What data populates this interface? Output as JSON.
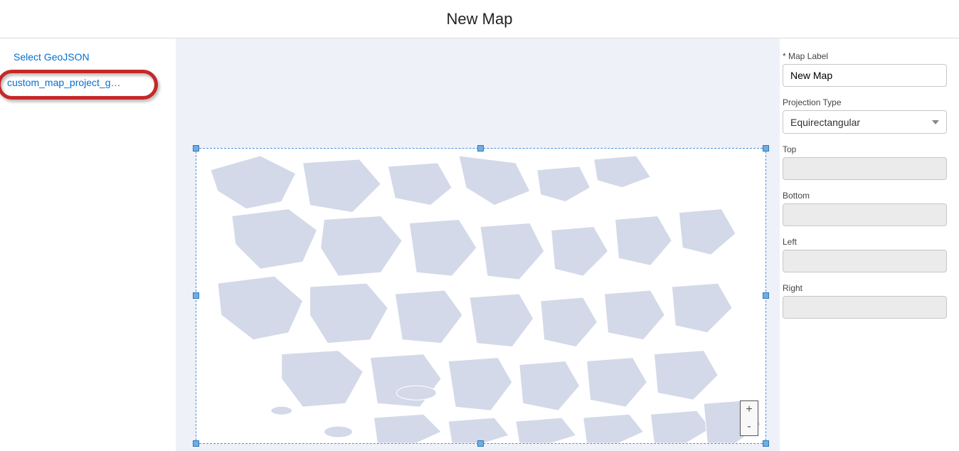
{
  "header": {
    "title": "New Map"
  },
  "sidebar": {
    "select_label": "Select GeoJSON",
    "items": [
      "custom_map_project_geoj..."
    ]
  },
  "zoom": {
    "in": "+",
    "out": "-"
  },
  "panel": {
    "map_label": {
      "label": "* Map Label",
      "value": "New Map"
    },
    "projection": {
      "label": "Projection Type",
      "value": "Equirectangular"
    },
    "top": {
      "label": "Top",
      "value": ""
    },
    "bottom": {
      "label": "Bottom",
      "value": ""
    },
    "left": {
      "label": "Left",
      "value": ""
    },
    "right": {
      "label": "Right",
      "value": ""
    }
  }
}
